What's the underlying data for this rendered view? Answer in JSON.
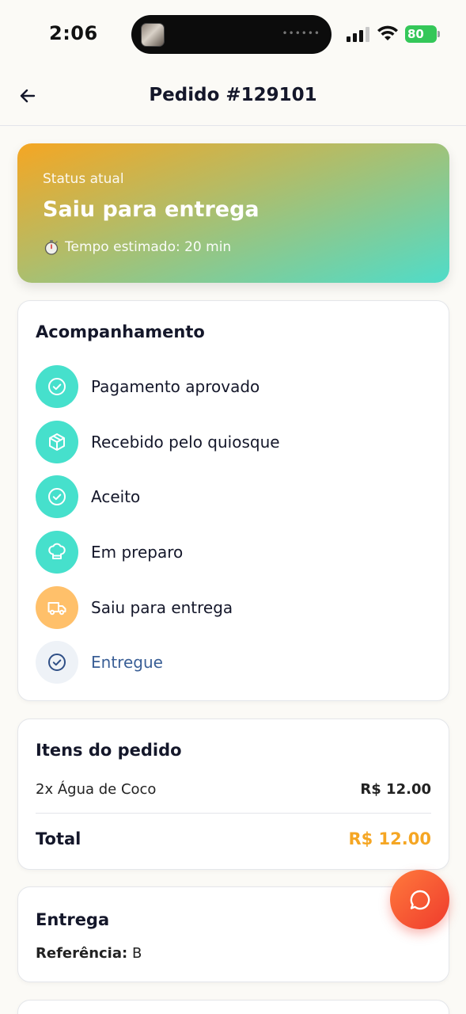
{
  "status_bar": {
    "time": "2:06",
    "battery": "80"
  },
  "header": {
    "title": "Pedido #129101"
  },
  "status_card": {
    "label": "Status atual",
    "value": "Saiu para entrega",
    "eta": "Tempo estimado: 20 min"
  },
  "tracking": {
    "title": "Acompanhamento",
    "steps": [
      {
        "label": "Pagamento aprovado",
        "state": "done",
        "icon": "check-circle-icon"
      },
      {
        "label": "Recebido pelo quiosque",
        "state": "done",
        "icon": "box-icon"
      },
      {
        "label": "Aceito",
        "state": "done",
        "icon": "check-circle-icon"
      },
      {
        "label": "Em preparo",
        "state": "done",
        "icon": "chef-hat-icon"
      },
      {
        "label": "Saiu para entrega",
        "state": "current",
        "icon": "truck-icon"
      },
      {
        "label": "Entregue",
        "state": "pending",
        "icon": "check-circle-icon"
      }
    ]
  },
  "items": {
    "title": "Itens do pedido",
    "list": [
      {
        "name": "2x Água de Coco",
        "price": "R$ 12.00"
      }
    ],
    "total_label": "Total",
    "total_value": "R$ 12.00"
  },
  "delivery": {
    "title": "Entrega",
    "reference_label": "Referência:",
    "reference_value": "B"
  },
  "colors": {
    "accent_orange": "#f5a623",
    "accent_teal": "#46e0cc",
    "fab_red": "#ef3b2d"
  }
}
